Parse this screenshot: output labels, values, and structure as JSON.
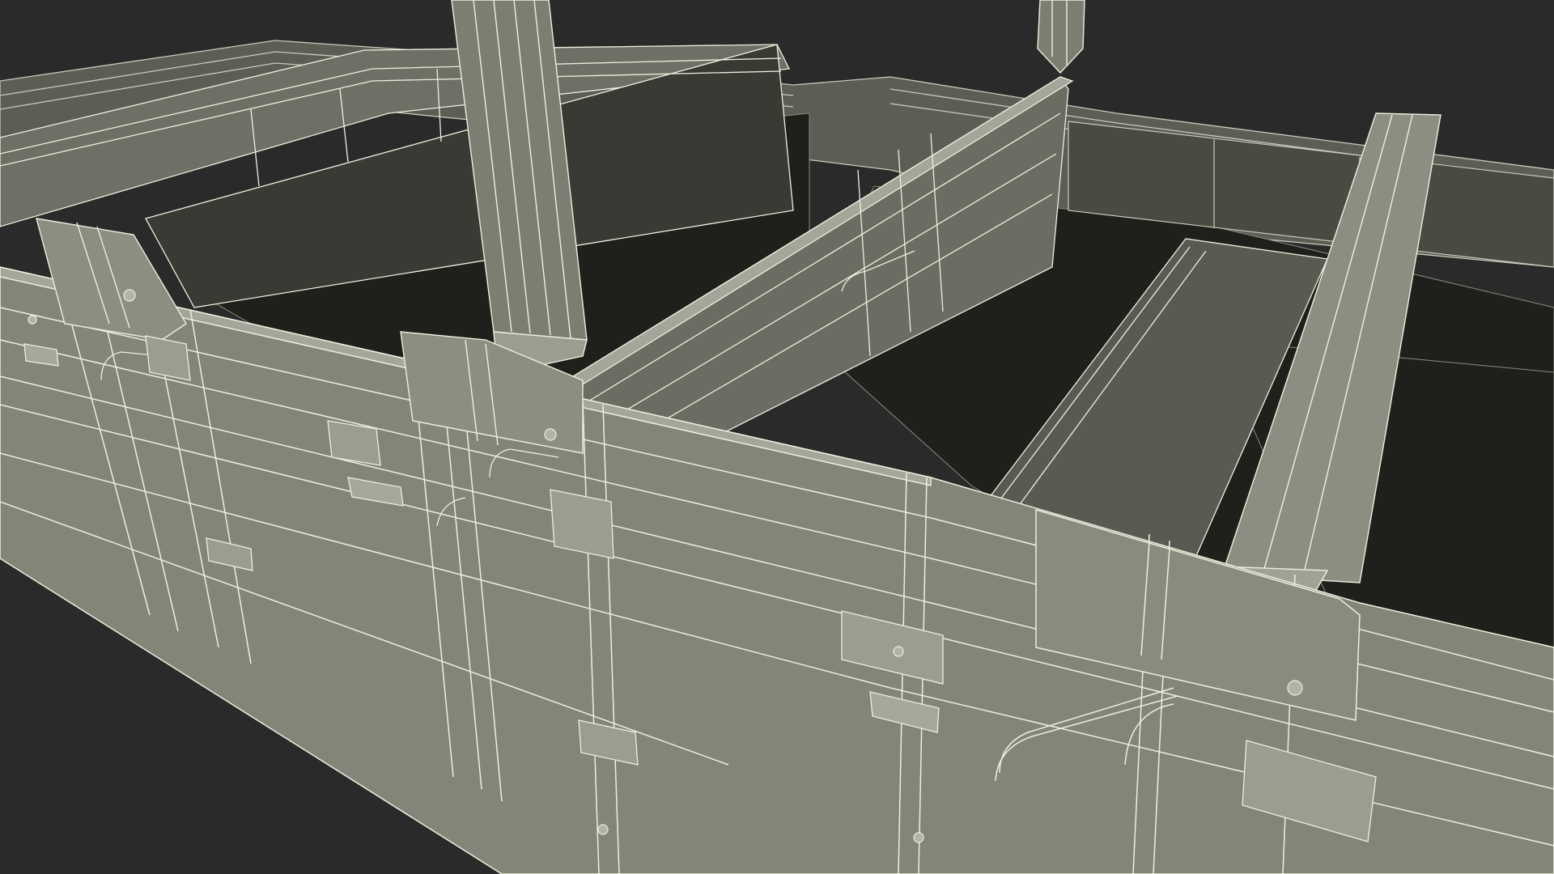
{
  "render": {
    "background": "#2a2a2a",
    "panel_face": "#86867a",
    "panel_face_light": "#97978b",
    "panel_face_dark": "#6f6f65",
    "shadow_face": "#1f1f1b",
    "interior_dark": "#262622",
    "wire_color": "#eeeede",
    "wire_dim": "#b8b8aa",
    "hardware": "#9c9c90"
  },
  "subject": {
    "style": "wireframe-on-shaded",
    "parts": [
      "outer-side-wall",
      "partition-walls",
      "bench",
      "posts",
      "hinges",
      "latches",
      "bolts"
    ]
  }
}
